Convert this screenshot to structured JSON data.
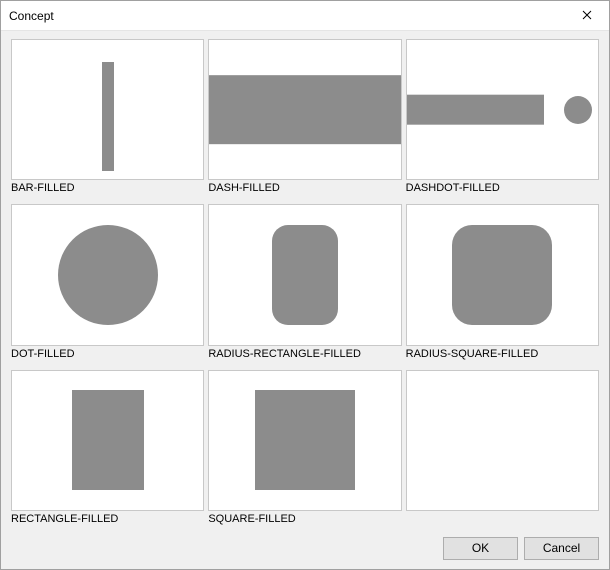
{
  "window": {
    "title": "Concept"
  },
  "buttons": {
    "ok": "OK",
    "cancel": "Cancel"
  },
  "items": [
    {
      "label": "BAR-FILLED"
    },
    {
      "label": "DASH-FILLED"
    },
    {
      "label": "DASHDOT-FILLED"
    },
    {
      "label": "DOT-FILLED"
    },
    {
      "label": "RADIUS-RECTANGLE-FILLED"
    },
    {
      "label": "RADIUS-SQUARE-FILLED"
    },
    {
      "label": "RECTANGLE-FILLED"
    },
    {
      "label": "SQUARE-FILLED"
    }
  ]
}
